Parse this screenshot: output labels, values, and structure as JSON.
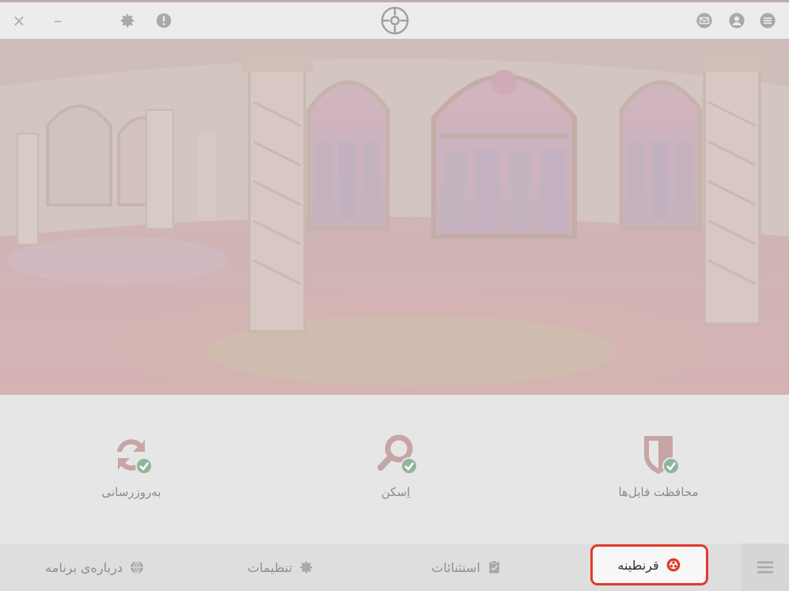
{
  "colors": {
    "accent": "#e23a2c",
    "icon_muted": "#c8a4a4",
    "check_green": "#8fb59a",
    "text_muted": "#8a8a8a",
    "titlebar_icon": "#a9a9a9"
  },
  "titlebar": {
    "close_symbol": "×",
    "minimize_symbol": "–",
    "icons": [
      "close-icon",
      "minimize-icon",
      "gear-icon",
      "alert-icon",
      "crosshair-logo-icon",
      "mail-icon",
      "user-icon",
      "menu-icon"
    ]
  },
  "features": [
    {
      "label": "به‌روزرسانی",
      "icon": "refresh-check-icon"
    },
    {
      "label": "اِسکن",
      "icon": "search-check-icon"
    },
    {
      "label": "محافظت فایل‌ها",
      "icon": "shield-check-icon"
    }
  ],
  "bottom_nav": {
    "about": "درباره‌ی برنامه",
    "settings": "تنظیمات",
    "exclusions": "استثنائات",
    "quarantine": "قرنطینه",
    "active": "quarantine"
  }
}
